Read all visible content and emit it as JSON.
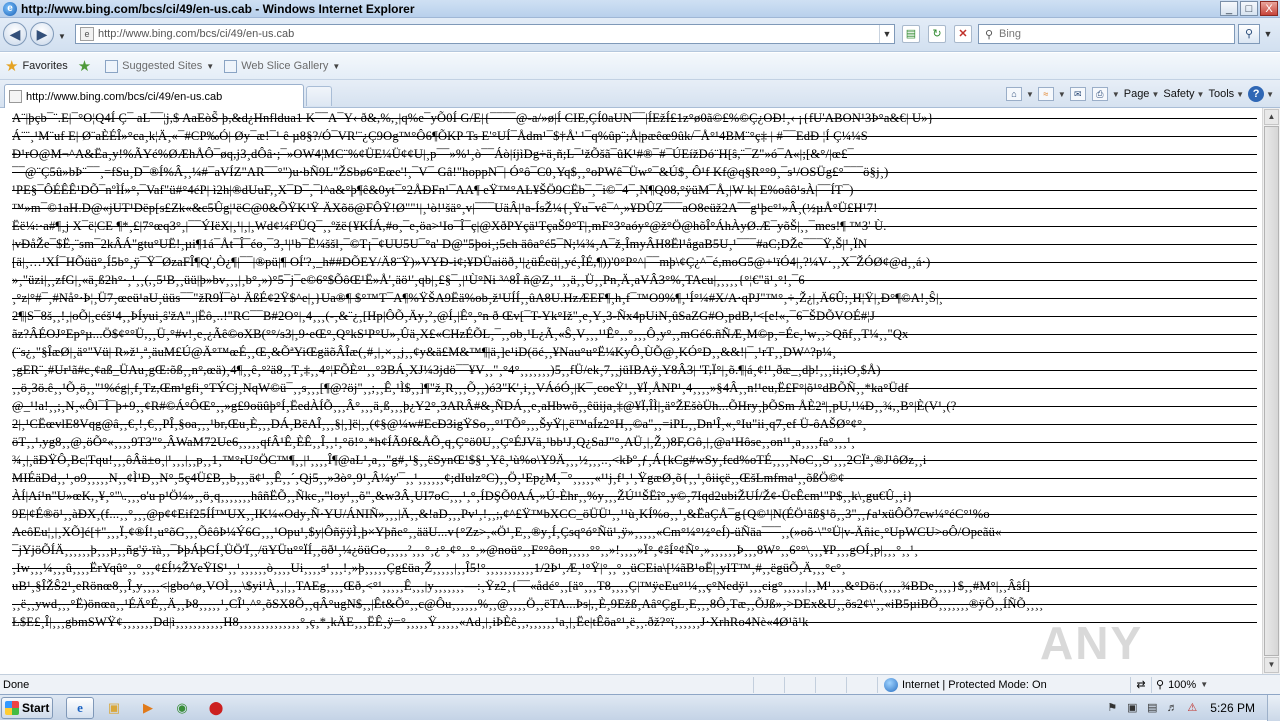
{
  "window": {
    "title": "http://www.bing.com/bcs/ci/49/en-us.cab - Windows Internet Explorer",
    "controls": [
      "_",
      "□",
      "X"
    ]
  },
  "address_bar": {
    "url": "http://www.bing.com/bcs/ci/49/en-us.cab"
  },
  "search": {
    "placeholder": "Bing"
  },
  "favorites_bar": {
    "favorites_label": "Favorites",
    "suggested_sites": "Suggested Sites",
    "web_slice_gallery": "Web Slice Gallery"
  },
  "tab": {
    "label": "http://www.bing.com/bcs/ci/49/en-us.cab"
  },
  "command_bar": {
    "page": "Page",
    "safety": "Safety",
    "tools": "Tools"
  },
  "content": {
    "lines": [
      "A¨|þçb¯¨.E|¯°O¦Q4Í Ç¯ aL¯¯¦j,$ AaEòS̃ þ,&d¿Hnfldua1 K¯¯A¯Y‹ ð&,%,¸|q%e¯yÕ0Í G/E|{¯¯¯¯@-a/»ø|Í CIE,ÇÍ0aUN¯¯|ÍEžÍ£1z°ø0ã©£%©Ç¿OÐ!¸‹ ¡{fU'ABON¹3Þ°a&€| U»}",
      "Á¨¨¸¹M¨uf E| Ø¨aÈÉÎ»°ca¸k¦Ä¸«¯#CP‰Ó| Øy¯æ!¯¹ ê µ8§?/Ó¯VR'¨¿Ç9Og™°Ô6¶ÕKP Ts E'°UÍ¯Ådm¹¯$†Å' ¹¯q%ûp¨;Å|pæêœ9ûk/¯Å°¹4BM¨°ç‡ | #¯¯EdÐ ¦Í Ç¼¼S",
      "Ð¹rO@M¬^A&Ëa¸y!%ÃYé%ØÆhÅÔ¯øq,j3¸dÔâ·;¯»OW4¦MC¨%¢ÜE¼Ü¢¢U|¸p¯¯»%¹¸ò¯¯Áò|íjìDg÷ä¸ñ;L¯¹žÕšã¯ûK¹#®¯#¯ÚEížDó¨H[ŝ,¨¯Z\"»ó¯A«|;[&°/|œ£¯",
      "¯¯@¨Ç5û»bÞ¨¯¯¸=fSu¸D¯®Í%Â¸¸¼#¯aVÍZ\"AR¯¯°\")u·bÑ9L\"ŽSbø6°Eœe'!¸¯V¯ Gâ!\"hoppN¯| Ó°ô¯C0¸Yq$¸¸°oPWê¯Üw°¯&Ú$¸ Ô¹f Kf@q§R°°9¸¯s¹/OSÜg£°¯¯¯ö§j¸)",
      "¹PE§¯ÔÉÊÊ¹DÕ¯nºÌÍ»°,¯Vaf\"ü#°4éP| ì2h|®dUuF,¸X¯D¯¸¯l^a&°þ¶ê&0yt¯°2ÅÐFn¹¯AA¶ eŸ™°AŁ¥ŠÖ9CËb¯¸¯i©¯4¯¸N¶Q08,°ÿüM¯Å¸|W k| E%oâô¹sÀ|¯¯ÍT¯)",
      "™»m¯©1aH.D@«jUT¹Dëp[s£Zk«&c5Ûg¦¹ëC@0&ÕŸK¹Ÿ ÄXõö@FÔŸ!Ø\"\"¹|¸¹ò!¹šä°¸v|¯¯¯UäÂ|¹a-ÍsŽ¼{¸Ÿu¯vê¯^¸»¥DÛZ¯¯¯aO8eüž2A¯¯g¹þc°¹»Â¸(½µÅ°Ü£H¹7!",
      "Ëë¼:·a#¶¸j X¯ë¦CE ¶*¸£|7°œq3°¸|¯¯ÝIëX|¸¹|¸|¸Wd¢¼f²ÜQ¯¸¸ºžë{¥KÍÁ,#o¸¯e¸öa>¹Io¯Î¯ç|@XðPYçä¹TçaŠ9°T|¸mF°3°aóy°@ž°Ö@hõÎ°ÁhÀyØ.Æ¯yõŠ|¸¸¯mes!¶ ™3' Ù.",
      "|vÐåŽe¯$Ë¸¨sm¯2kÂÁ\"gtu°UË!¸µi¶1á¯Åt¯Î¯éo¸¯3¸¹|¹b¯Ë¼ššl¸¯©T¡¯¢UU5U¯°a' D@\"5þoi¸;5ch äôa°é5¯N;¼¾¸A¯ž¸ÎmyÂH8Ël¹ågaB5U¸¹¯¯¯#aC;DŽe¯¯¯Ÿ,Š|¹¸ÏN",
      "[ä|¸…¹XÍ¯HÕüü°¸Í5b°¸ÿ¯Ÿ¯ØzaFÎ¶Q'¸Ò¿¶|¯¯|®pü|¶ OÍ'?¸_h##DÕEY/Ä8¨Ÿ)»VYÐ-i¢;¥DÜaiöð¸¹|¿üÉeü|¸yé¸ÎÉ,¶))'0°P°^|¯¯mþ\\¢Ç¿^¯é,moG5@+¹ïÓ4|¸?¼V·¸¸X¯ŽÓØ¢@d¸¸á·)",
      "»¸\"üzi|¸¸zfG|¸«ä¸ß2h°·¸¹¸¸(,¸5¹B¸¸üü|þ»bv¸¸¸|¸b°¸»)°5¯j¯e©6°$ÕôŒ¹Ë»Å'¸äö¹'¸qb|¸£§¯¸|¹Ù°Ni ³^8Î ñ@Z¸¹¹¸¸ä¸¸Ü¸¸Pn¸Ä¸aVÂ3°%¸TAcu|¸¸¸¸¸{°¦€\"ä¹¸°!¸¯6",
      "¸°z|°#¯¸#Nå°·Þ¦¸Ü7¸œeü¹aU¸üüs¯¯\"žR9Ï¯ò¹ ÄßÉ¢2Ÿ$^e|¸}Ua®¶ $°™T¯A¶%ŸŠA9Ëä%ob¸ž¹UÍÍ¸¸ûA8U.HzÆEF¶¸h¸f¯™O9%¶¸¹Í°¼#X/A·qPJ\"™°¸÷¸Ž¿|¸Ä6Û;¸H¦Ÿ|¸Ð°¶©A!¸Ŝ|¸",
      "2¶|S¯8š¸¸!¸|oÕ|¸céš¹4¸¸ÞÍyui¸ŝ'žA\"¸|Ëô¸..!\"RC¯¯B#2O°|¸4¸¸¸(-¸&¨¿¸[Hp|ÔÕ¸Äy¸²¸@Í¸|Ê°¸°n ð Œv[¯T-Yk°Iž\"¸e¸Y¸3-Ñx4pUiN¸ûSaZG#O¸pdB,¹<[e!«¸¯6¯ŠDÕVOÉ#¦J",
      "ãz?ÂÉOJ°Ep°µ...Ö$¢°°Ü,¸¸Ü¸°#v!¸e¸¿Ãê©oXB(°°/s3|¸9·eŒ°¸Q°kS¹P°U»¸Ûä¸X£«CHzÉÕL¸¯¸¸ob¸¹L¿Ã¸«Ŝ¸V¸¸¸¹¹Ê°¸¸°¸¸¸Ô¸y°¸¸mGé6.ñÑÆ¸M©p¸=Éc¸¹w¸¸>Qñf¸¸T¼¸¸\"Qx",
      "(¨s¿¸\"§ÎæØ|¸ä°\"Vü| R»ž¹¸ª¸äuM£Ú@Ä°™œÉ¸¸Œ¸&ÕªYiŒgäõÂÎæ(¸#¸|¸×¸¸j¸¸¢y&ä£M&™¶|ä¸]e¹iD(öé¸¸¥Nau°u°Ë¼KyÔ¸ÙÕ@¸KÓ°D¸¸&&!|¯¸¹rT¸¸DW^?p¼¸",
      "¸gER¨¸#Ur¹ã#c¸¢aß_ÜAu¸gŒ:õß¸¸n°,œä)¸4¶¸¸ê¸°²ä8¸¸T¸‡¸¸4°¦FÕÈ°¹¸¸°3BÁ¸XJ¼3jdö¯¯¥V¸¸\"¸°4°¸¸¸¸¸¸¸)5¸¸fÜ/ek¸7¸¸jüIBAÿ¸Y8Â3| 'T,Ï°|¸õ.¶|á¸¢!¹¸ðæ_¸dþ!¸¸¸ii;iO¸$Å)",
      "¸¸ö¸3ö.ê¸¸¹Õ¸ö¸¸\"¹%ég|¸f¸Tz,Œm¹gfi¸°TÝCj¸NqW©ü¯¸¸s¸¸¸[¶@?öj\"¸¸;¸¸Ê¸¹Ì$¸¸]¶\"ž¸R¸¸¸Õ¸¸)ó3\"K'¸i¸¸VÁóÓ¸|K¯¸coeŸ¹¸¸¥Ï¸ÅNP¹¸4¸¸¸¸»§4Â¸¸n!¹eu,Ë£F°|õ¹°dBÕÑ¸¸*ka°Üdf",
      "@_¹!a!¸¸;¸N¸«Ôl¯Î¯þ+9¸¸¢R#©Á°ÔŒ°¸¸»g£9oüûþ°Í¸ËedÀÍÕ¸¸¸Â°¸¸¸ä¸ß¸¸¸þ¿Y2°¸3ARÂ#&¸ÑDÁ¸¸e¸aHbwõ¸¸êüija¸‡@¥Ï,ÎÌ|¸ä°ŽEšòÜh...ÕHry¸þÕSm ÅÈ2ª|¸pU,¹¼Ð¸¸¾,¸B°|È(V¹¸(?",
      "2|¸¹CËœvlE8Vqg@â¸¸€¸!¸€¸¸PÎ¸§oa¸¸¸¹br,Œu¸È¸¸¸DÁ¸BëAÎ¸¸¸§|¸]ë|¸¸(¢§@¼w#EcÐ3igŸSo¸¸°¹TÕ°¸¸¸ŠyŸ|¸ë™aÍz2°H¸¸©a\"¸¸=iPL¸¸Dn¹Î¸«¸°Iu\"ii¸q7¸ef Ü-ôAŠØ°¢°¸",
      "öT¸¸¹,yg8¸¸@¸öÕ°«¸¸¸¸9T3\"°¸ÂWaM72Ue6¸¸¸¸¸qfÂ¹Ê¸ÈÊ¸¸Î¸¸!¸°ö!°¸*h¢ÍÃ9f&ÅÕ¸q¸Ç°ö0U¸¸Ç°ÉJVä¸¹bb¹J¸Q¿SaJ\"°¸AÜ¸|¸Ž¸)8F,Gô¸|¸@a¹Hôse¸¸on¹¹¸a¸¸¸¸fa°¸¸¸¹¸",
      "¾¸|¸äÐŸÔ¸Bc¦Tqu!¸¸¸ôÂä±o¸|¹¸¸¸|¸¸p¸¸1¸™°rU°ÖC™¶¸¸|¹¸¸¸¸Î¶@aL¹¸a¸¸\"g#¸¹§¸¸ëSynŒ¹$§¹¸Yê¸¹ù%o\\Y9Ä¸¸¸½¸¸¸..¸<kÞº¸ƒ¸Á{kCg#wSy¸fcd%oTÉ¸¸¸¸NoC¸¸S¹¸¸¸2CÏª¸®J¹ôØz¸¸i",
      "MIÉäDd¸¸¹¸o9¸¸¸¸¸N¸¸¢Ì¹Ð¸¸N°¸5ç4Ü£B¸¸b¸¸¸ä¢¹¸¸Ê¸¸´¸Qj5¸¸»3ò°¸9¹¸Â¼y'¯¸¸¹¸¸¸¸¸¸¢;dIulz°C)¸¸Ö¸¹Ep¿M¸¯°¸¸¸¸¸«¹¹j¸f¹¸¹¸ŸgæØ¸õ{¸¸¹¸ôiiçë¸¸ŒšLmfma¹¸¸õßÖ©¢",
      "ÀÍ|Aí¹n\"U»œK,¸¥¸°\"\\.¸¸¸o'u p¹Ö¼»¸¸ö¸q¸¸¸¸¸¸¸hâñËÕ¸¸Ñkc¸,\"loy¹¸¸õ\"¸&w3Â¸UI7oC¸¸¸¹¸°¸ÍDŞÕ0AÁ¸»Ú-Èhr¸¸%y¸¸¸ŽÚ¹¹ŠËî°¸y©¸7Iqd2ubiŽUÍ/Ž¢·ÜeÊcm¹\"P$¸¸k\\¸gu€Û¸¸i}",
      "9E|¢É®ö¹¸¸àÐX¸(f...¸¸°¸¸¸@p¢¢Eif25ÍÍ™UX¸¸IK¼«Ody¸Ñ·YU/ÁNIÑ»¸¸¸|Ä¸¸&!aD¸¸¸Pv¹¸!¸¸;,¢^£Ÿ™bXCC_öÜÜ¹¸¸¹¹ù¸KÍ%o¸¸¹¸&ËaÇÅ¯g{Q©¹|N(ÉÖ¹ãß§¹õ¸¸3\"¸¸ƒa¹xüÔÕ7cw¼°éC°¹%o",
      "AeôEu¦¸|¸XÕ]é[†\"¸¸¸Ï¸¢®Í!¸u°õG¸¸¸ÕêôÞ¼Ý6G¸¸¸¹Opu¹¸$y|ÔñÿÿÌ¸þ×Yþñe°¸¸ääU...v{°Zz>¸«Ö¹¸E¸¸®y¸Í¸Çsq°ó°Ñü¹¸ÿ»¸¸¸¸¸«Cm°¼°½°eÍ)-üÑäa¯¯¯¸¸(»oõ·\\\"°Ü|v-Äñic¸°UpWCU>oÔ/Opeãü«",
      "¯jYjöÕÍÄ¸¸¸¸¸¸þ¸¸¸µ¸¸ñg'ÿ·ïà¸¸¯ÞþÁþGÍ¸ÜÖ'Ï¸¸/üYÜu°°ÏÍ¸¸öð¹¸¼¿öüGo¸¸¸¸¸²¸¸¸°¸¿°¸¢°¸¸°¸»@noü°¸¸F°°ôon¸¸¸¸¸°°¸¸»!¸¸¸¸»Ï°¸¢ŝÍ°¢Ñ°¸»¸¸¸¸¸¸Þ¸¸¸8W°¸¸6°°\\¸¸¸¥P¸¸¸gOÍ¸p|¸¸¸°¸¸¹¸",
      "¸Iw¸¸¸¼¸¸¸û¸¸¸¸ËrYqû°¸¸°¸¸¸¢£Í½ŽYeŸIS¹¸¸¹¸¸¸¸¸¸ò¸¸¸¸Ui¸¸¸¸s¹¸¸¸!¸»þ¸¸¸¸¸Çg£üa¸Ž¸¸¸¸¸|¸¸Î5!°¸¸¸¸¸¸¸¸¸¸¸1/2Þ¹¸Æ¸¹°Ÿ|°¸¸°¸¸üCEia\\[¼ãB¹oË|¸yIT™¸#¸¸ëgüÕ¸Ä¸¸¸°c°¸",
      "uB¹¸§ÎŽŜ2¹¸eRönœ8¸¸Î¸y¸¸¸¸<|gbo^ø¸VOÌ¸¸¸\\$yi¹À¸¸|¸¸TAEg¸¸¸¸Œð¸<°¹¸¸¸¸¸Ê¸¸¸|y¸¸¸¸¸¸¸—:¸Ÿz2¸{¯¯«ådé°¸¸[ä°¸¸¸T8¸¸¸¸Ç|™ÿeEu°¹¼¸¸ç°Nedÿ¹¸¸¸cig°¸¸¸¸¸|¸¸M¹¸¸¸&°Dö:(¸¸¸¸¾BDe¸¸¸¸}$¸¸#M°|¸¸ÂŝÍ]",
      "¸¸ë¸¸ywd¸¸¸°Ë)önœa¸¸¹ÉÄ°É¸¸Ä¸¸Þ8¸¸¸¸¸¹¸CÎ¹¸^°¸õSX8Õ¸¸qÂ°ugN$¸¸|Êt&Õ°¸¸c@Ôu¸¸¸¸¸¸%¸¸@¸¸¸¸Ö¸¸ëTA...Þs|,¸È¸9Ežß¸Aâ°ÇgL¸E¸¸¸8Ô¸Tæ¸¸ÕJß»¸>DEx&U¸¸õs2¢\\'¸¸«iB5µiBÕ¸¸¸¸¸¸¸®ÿÕ¸¸ÍÑÕ¸¸¸¸",
      "Ł$E£¸Î|¸¸¸gbmSWŸ¢¸¸¸¸¸¸¸Dd|ì¸¸¸¸¸¸¸¸¸¸¸H8¸¸¸¸¸¸¸¸¸¸¸¸¸¸°¸ç¸*¸kÄE¸¸¸ËÊ¸ÿ=°¸¸¸¸¸Ÿ¸¸¸¸¸«Ad¸|¸iÞÈê¸¸,¸¸¸¸¸¸¹a¸|¸Ëe|tÊõa°¹¸ë¸¸.ðž?°ϊ¸¸¸¸¸¸J·XrhRo4Nè«4Ø¹ã¹k"
    ]
  },
  "watermark": "ANY RUN",
  "status_bar": {
    "text": "Done",
    "zone": "Internet | Protected Mode: On",
    "zoom": "100%"
  },
  "taskbar": {
    "start_label": "Start",
    "time": "5:26 PM"
  }
}
